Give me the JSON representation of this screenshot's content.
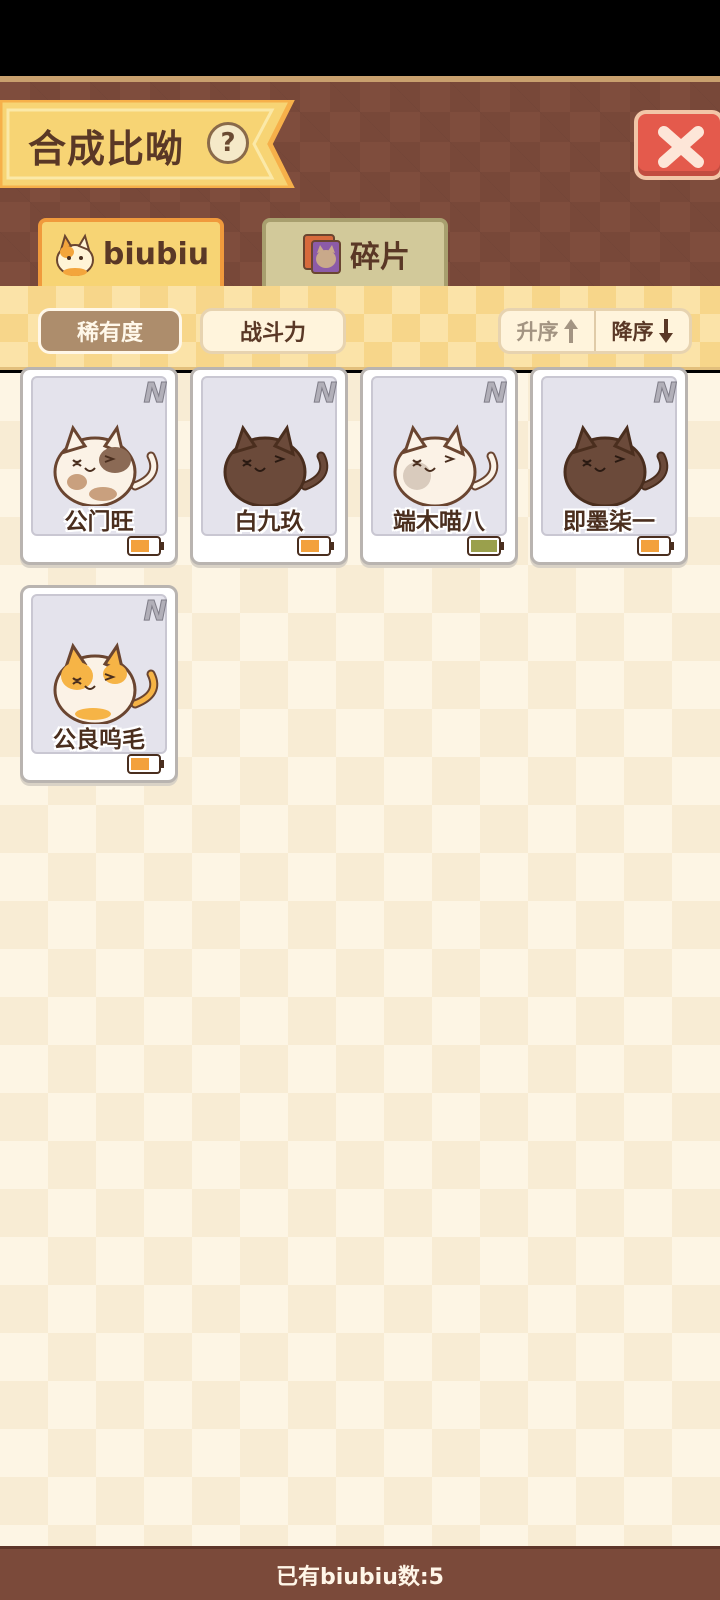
{
  "header": {
    "title": "合成比呦",
    "help_label": "?"
  },
  "tabs": [
    {
      "label": "biubiu",
      "active": true
    },
    {
      "label": "碎片",
      "active": false
    }
  ],
  "filters": {
    "rarity_label": "稀有度",
    "power_label": "战斗力",
    "sort_asc_label": "升序",
    "sort_desc_label": "降序"
  },
  "cards": [
    {
      "name": "公门旺",
      "rarity": "N",
      "coat": "calico-brown",
      "battery": "orange"
    },
    {
      "name": "白九玖",
      "rarity": "N",
      "coat": "dark-brown",
      "battery": "orange"
    },
    {
      "name": "端木喵八",
      "rarity": "N",
      "coat": "cream-white",
      "battery": "green"
    },
    {
      "name": "即墨柒一",
      "rarity": "N",
      "coat": "dark-brown",
      "battery": "orange"
    },
    {
      "name": "公良呜毛",
      "rarity": "N",
      "coat": "ginger-white",
      "battery": "orange"
    }
  ],
  "footer": {
    "count_text": "已有biubiu数:5"
  },
  "colors": {
    "panel": "#7f4d3d",
    "ribbon": "#f7d474",
    "close": "#e45a4c",
    "footer": "#7b4a3a"
  }
}
